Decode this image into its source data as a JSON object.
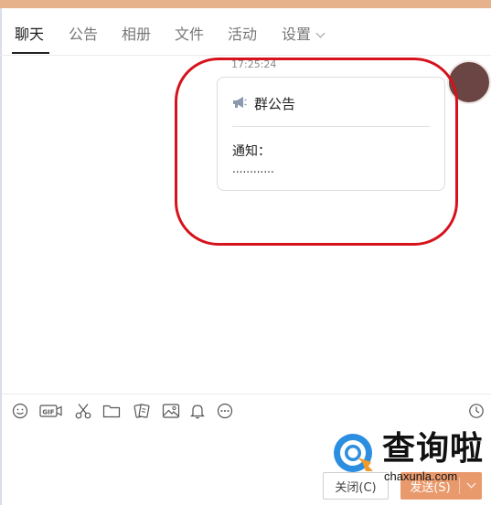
{
  "tabs": [
    {
      "label": "聊天",
      "active": true
    },
    {
      "label": "公告",
      "active": false
    },
    {
      "label": "相册",
      "active": false
    },
    {
      "label": "文件",
      "active": false
    },
    {
      "label": "活动",
      "active": false
    },
    {
      "label": "设置",
      "active": false
    }
  ],
  "message": {
    "timestamp": "17:25:24",
    "card": {
      "icon": "megaphone-icon",
      "title": "群公告",
      "label": "通知：",
      "body": "............"
    }
  },
  "toolbar": {
    "icons": [
      "emoji-icon",
      "gif-icon",
      "scissors-icon",
      "folder-icon",
      "shake-icon",
      "image-icon",
      "bell-icon",
      "more-icon",
      "history-clock-icon"
    ]
  },
  "watermark": {
    "title": "查询啦",
    "domain": "chaxunla.com"
  },
  "buttons": {
    "close": "关闭(C)",
    "send": "发送(S)"
  },
  "colors": {
    "accent": "#e99a6d",
    "annotation": "#d6121c",
    "titlebar": "#e6b28c",
    "watermark_blue": "#2c8ee0",
    "watermark_orange": "#f29a28"
  }
}
